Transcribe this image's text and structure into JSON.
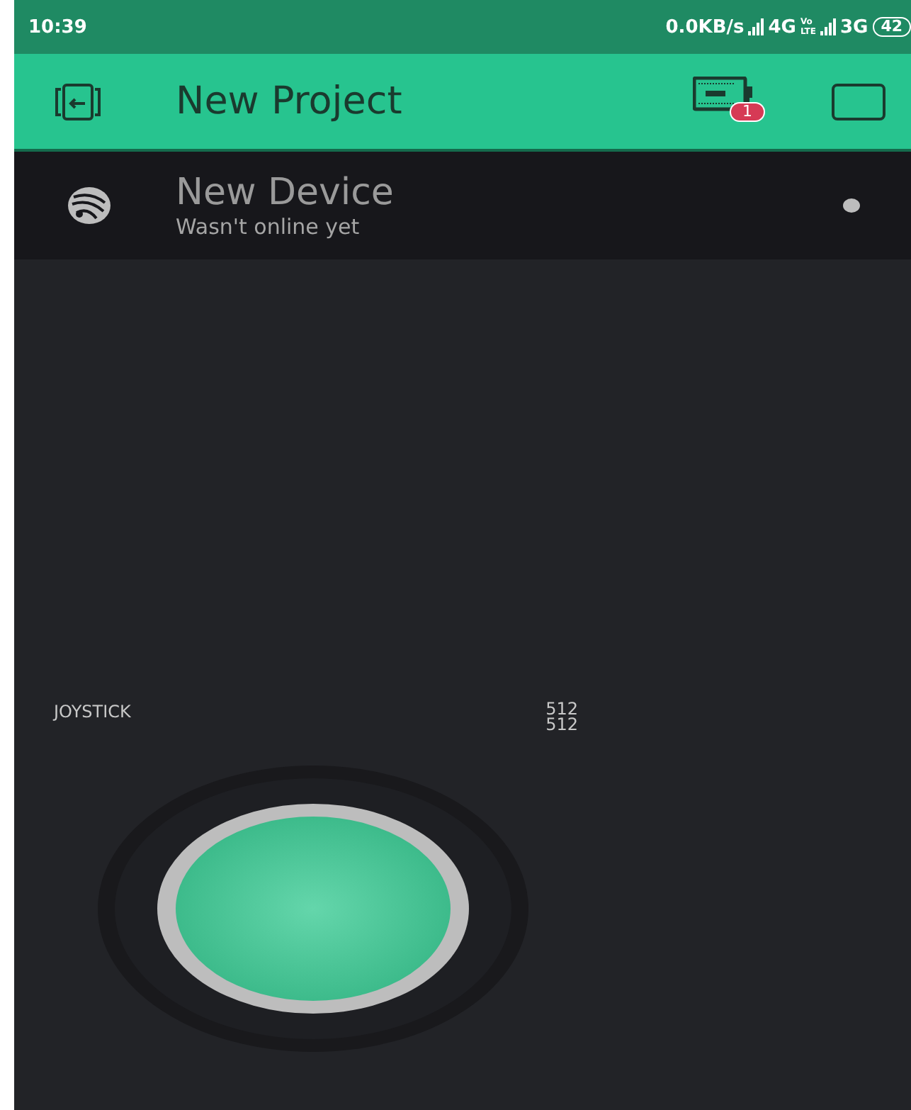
{
  "status_bar": {
    "time": "10:39",
    "speed": "0.0KB/s",
    "network_1": "4G",
    "volte": [
      "Vo",
      "LTE"
    ],
    "network_2": "3G",
    "battery": "42"
  },
  "app_bar": {
    "title": "New Project",
    "notification_count": "1"
  },
  "device": {
    "name": "New Device",
    "status": "Wasn't online yet",
    "online": false
  },
  "joystick": {
    "label": "JOYSTICK",
    "x_value": "512",
    "y_value": "512"
  }
}
